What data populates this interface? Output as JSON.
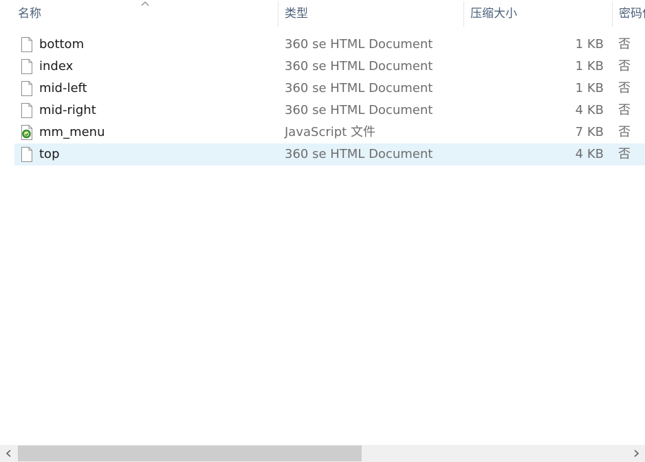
{
  "columns": {
    "name": "名称",
    "type": "类型",
    "compressed_size": "压缩大小",
    "password": "密码保护"
  },
  "sort": {
    "column": "name",
    "direction": "ascending",
    "indicator_icon": "chevron-up-icon"
  },
  "files": [
    {
      "name": "bottom",
      "type": "360 se HTML Document",
      "size": "1 KB",
      "password": "否",
      "icon": "html-file-icon",
      "selected": false
    },
    {
      "name": "index",
      "type": "360 se HTML Document",
      "size": "1 KB",
      "password": "否",
      "icon": "html-file-icon",
      "selected": false
    },
    {
      "name": "mid-left",
      "type": "360 se HTML Document",
      "size": "1 KB",
      "password": "否",
      "icon": "html-file-icon",
      "selected": false
    },
    {
      "name": "mid-right",
      "type": "360 se HTML Document",
      "size": "4 KB",
      "password": "否",
      "icon": "html-file-icon",
      "selected": false
    },
    {
      "name": "mm_menu",
      "type": "JavaScript 文件",
      "size": "7 KB",
      "password": "否",
      "icon": "javascript-file-icon",
      "selected": false
    },
    {
      "name": "top",
      "type": "360 se HTML Document",
      "size": "4 KB",
      "password": "否",
      "icon": "html-file-icon",
      "selected": true
    }
  ],
  "scrollbar": {
    "left_icon": "chevron-left-icon",
    "right_icon": "chevron-right-icon",
    "position_fraction": 0.0
  },
  "colors": {
    "selected_row": "#e5f3fb",
    "header_text": "#4c607a",
    "secondary_text": "#6d6d6d",
    "js_icon_green": "#3c9a2e"
  }
}
